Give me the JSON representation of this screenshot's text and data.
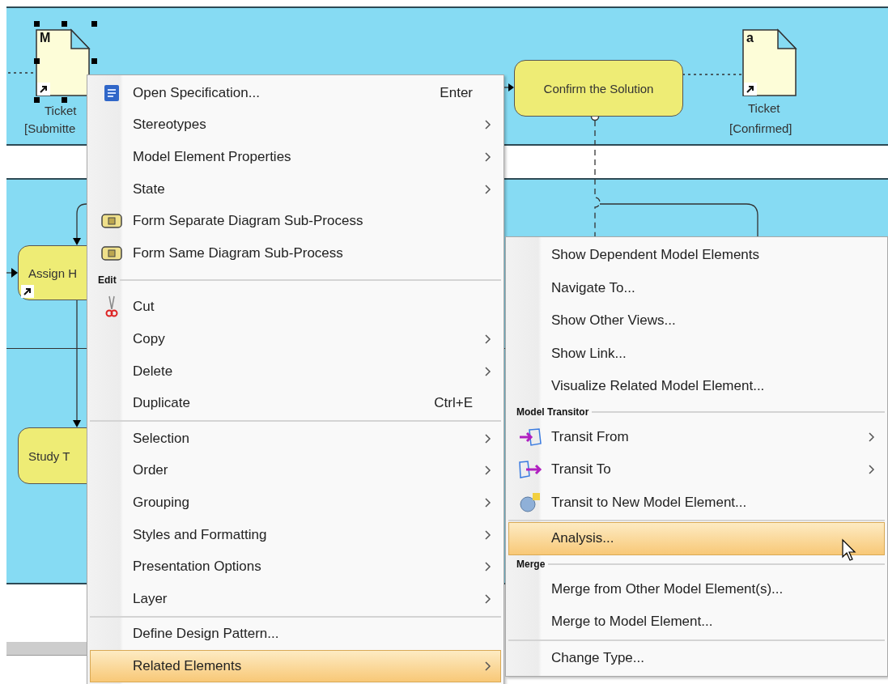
{
  "diagram": {
    "objects": [
      {
        "marker": "M",
        "label": "Ticket",
        "state": "[Submitte",
        "selected": true
      },
      {
        "marker": "a",
        "label": "Ticket",
        "state": "[Confirmed]",
        "selected": false
      }
    ],
    "actions": [
      {
        "label": "Confirm the Solution"
      },
      {
        "label": "Assign H"
      },
      {
        "label": "Study T"
      }
    ]
  },
  "context_menu": {
    "items": [
      {
        "kind": "spec",
        "label": "Open Specification...",
        "shortcut": "Enter",
        "submenu": false,
        "selected": false
      },
      {
        "kind": "item",
        "label": "Stereotypes",
        "submenu": true,
        "selected": false
      },
      {
        "kind": "item",
        "label": "Model Element Properties",
        "submenu": true,
        "selected": false
      },
      {
        "kind": "item",
        "label": "State",
        "submenu": true,
        "selected": false
      },
      {
        "kind": "subprocess",
        "label": "Form Separate Diagram Sub-Process",
        "submenu": false,
        "selected": false
      },
      {
        "kind": "subprocess",
        "label": "Form Same Diagram Sub-Process",
        "submenu": false,
        "selected": false
      },
      {
        "kind": "header",
        "label": "Edit"
      },
      {
        "kind": "cut",
        "label": "Cut",
        "submenu": false,
        "selected": false
      },
      {
        "kind": "item",
        "label": "Copy",
        "submenu": true,
        "selected": false
      },
      {
        "kind": "item",
        "label": "Delete",
        "submenu": true,
        "selected": false
      },
      {
        "kind": "item",
        "label": "Duplicate",
        "shortcut": "Ctrl+E",
        "submenu": false,
        "selected": false
      },
      {
        "kind": "separator"
      },
      {
        "kind": "item",
        "label": "Selection",
        "submenu": true,
        "selected": false
      },
      {
        "kind": "item",
        "label": "Order",
        "submenu": true,
        "selected": false
      },
      {
        "kind": "item",
        "label": "Grouping",
        "submenu": true,
        "selected": false
      },
      {
        "kind": "item",
        "label": "Styles and Formatting",
        "submenu": true,
        "selected": false
      },
      {
        "kind": "item",
        "label": "Presentation Options",
        "submenu": true,
        "selected": false
      },
      {
        "kind": "item",
        "label": "Layer",
        "submenu": true,
        "selected": false
      },
      {
        "kind": "separator"
      },
      {
        "kind": "item",
        "label": "Define Design Pattern...",
        "submenu": false,
        "selected": false
      },
      {
        "kind": "item",
        "label": "Related Elements",
        "submenu": true,
        "selected": true
      }
    ]
  },
  "submenu": {
    "items": [
      {
        "kind": "item",
        "label": "Show Dependent Model Elements",
        "submenu": false,
        "selected": false
      },
      {
        "kind": "item",
        "label": "Navigate To...",
        "submenu": false,
        "selected": false
      },
      {
        "kind": "item",
        "label": "Show Other Views...",
        "submenu": false,
        "selected": false
      },
      {
        "kind": "item",
        "label": "Show Link...",
        "submenu": false,
        "selected": false
      },
      {
        "kind": "item",
        "label": "Visualize Related Model Element...",
        "submenu": false,
        "selected": false
      },
      {
        "kind": "header",
        "label": "Model Transitor"
      },
      {
        "kind": "transitfrom",
        "label": "Transit From",
        "submenu": true,
        "selected": false
      },
      {
        "kind": "transitto",
        "label": "Transit To",
        "submenu": true,
        "selected": false
      },
      {
        "kind": "newelement",
        "label": "Transit to New Model Element...",
        "submenu": false,
        "selected": false
      },
      {
        "kind": "separator"
      },
      {
        "kind": "item",
        "label": "Analysis...",
        "submenu": false,
        "selected": true
      },
      {
        "kind": "header",
        "label": "Merge"
      },
      {
        "kind": "item",
        "label": "Merge from Other Model Element(s)...",
        "submenu": false,
        "selected": false
      },
      {
        "kind": "item",
        "label": "Merge to Model Element...",
        "submenu": false,
        "selected": false
      },
      {
        "kind": "separator"
      },
      {
        "kind": "item",
        "label": "Change Type...",
        "submenu": false,
        "selected": false
      }
    ]
  }
}
